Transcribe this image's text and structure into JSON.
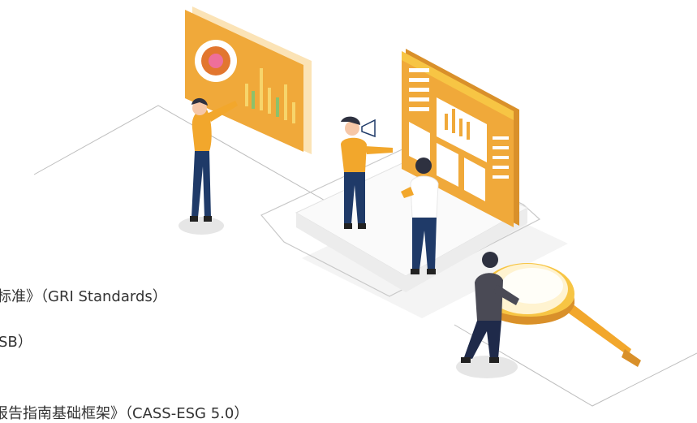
{
  "text_lines": [
    "标准》（GRI Standards）",
    "SB）",
    "报告指南基础框架》（CASS-ESG 5.0）"
  ],
  "colors": {
    "orange": "#F0A93A",
    "orange_dark": "#D9902A",
    "yellow": "#F7C544",
    "navy": "#1F3A68",
    "gray_platform": "#F2F2F2",
    "outline": "#BFBFBF"
  },
  "icons": {
    "magnifier": "magnifying-glass-icon",
    "megaphone": "megaphone-icon",
    "donut": "donut-chart-icon",
    "bars": "bar-chart-icon"
  }
}
